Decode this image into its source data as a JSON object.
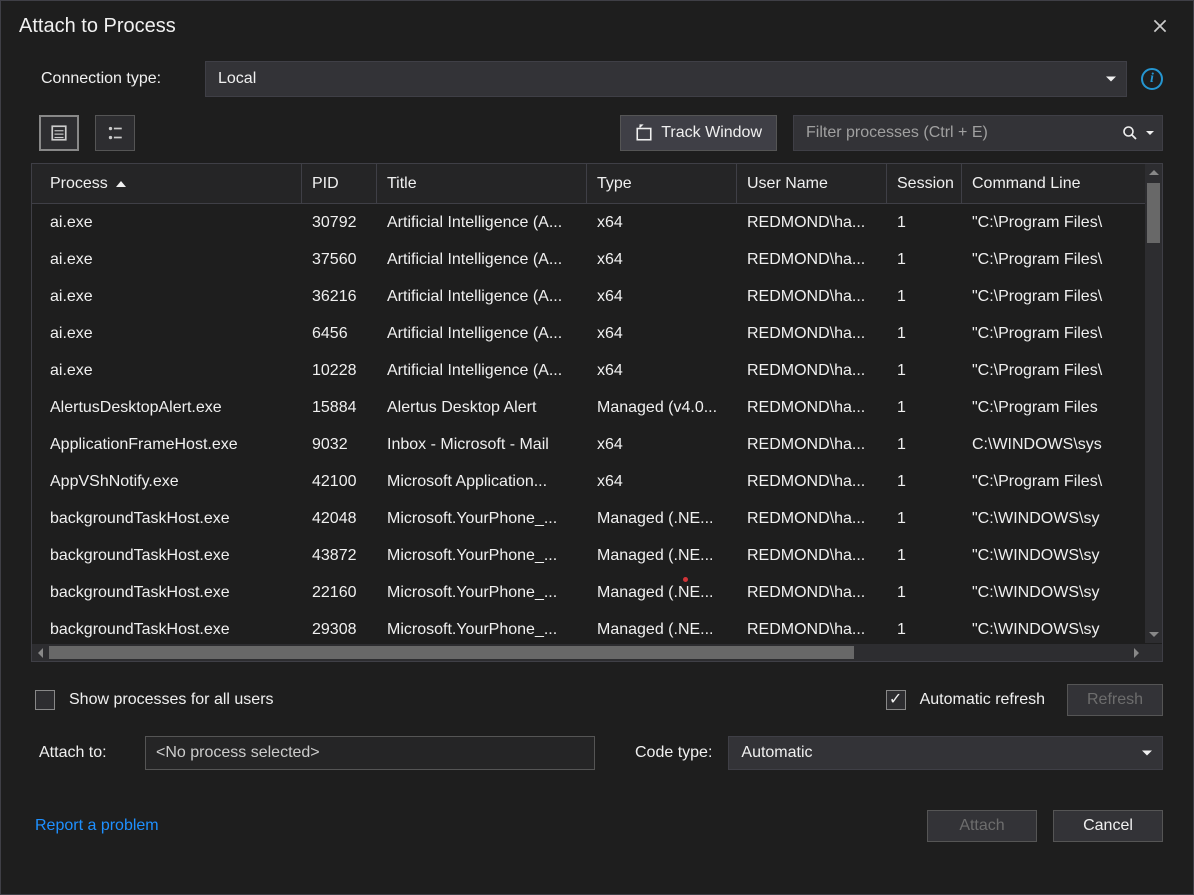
{
  "dialog": {
    "title": "Attach to Process"
  },
  "connection": {
    "label": "Connection type:",
    "value": "Local"
  },
  "toolbar": {
    "track_window": "Track Window",
    "filter_placeholder": "Filter processes (Ctrl + E)"
  },
  "columns": {
    "process": "Process",
    "pid": "PID",
    "title": "Title",
    "type": "Type",
    "user": "User Name",
    "session": "Session",
    "cmd": "Command Line"
  },
  "rows": [
    {
      "process": "ai.exe",
      "pid": "30792",
      "title": "Artificial Intelligence (A...",
      "type": "x64",
      "user": "REDMOND\\ha...",
      "session": "1",
      "cmd": "\"C:\\Program Files\\"
    },
    {
      "process": "ai.exe",
      "pid": "37560",
      "title": "Artificial Intelligence (A...",
      "type": "x64",
      "user": "REDMOND\\ha...",
      "session": "1",
      "cmd": "\"C:\\Program Files\\"
    },
    {
      "process": "ai.exe",
      "pid": "36216",
      "title": "Artificial Intelligence (A...",
      "type": "x64",
      "user": "REDMOND\\ha...",
      "session": "1",
      "cmd": "\"C:\\Program Files\\"
    },
    {
      "process": "ai.exe",
      "pid": "6456",
      "title": "Artificial Intelligence (A...",
      "type": "x64",
      "user": "REDMOND\\ha...",
      "session": "1",
      "cmd": "\"C:\\Program Files\\"
    },
    {
      "process": "ai.exe",
      "pid": "10228",
      "title": "Artificial Intelligence (A...",
      "type": "x64",
      "user": "REDMOND\\ha...",
      "session": "1",
      "cmd": "\"C:\\Program Files\\"
    },
    {
      "process": "AlertusDesktopAlert.exe",
      "pid": "15884",
      "title": "Alertus Desktop Alert",
      "type": "Managed (v4.0...",
      "user": "REDMOND\\ha...",
      "session": "1",
      "cmd": "\"C:\\Program Files"
    },
    {
      "process": "ApplicationFrameHost.exe",
      "pid": "9032",
      "title": "Inbox - Microsoft - Mail",
      "type": "x64",
      "user": "REDMOND\\ha...",
      "session": "1",
      "cmd": "C:\\WINDOWS\\sys"
    },
    {
      "process": "AppVShNotify.exe",
      "pid": "42100",
      "title": "Microsoft Application...",
      "type": "x64",
      "user": "REDMOND\\ha...",
      "session": "1",
      "cmd": "\"C:\\Program Files\\"
    },
    {
      "process": "backgroundTaskHost.exe",
      "pid": "42048",
      "title": "Microsoft.YourPhone_...",
      "type": "Managed (.NE...",
      "user": "REDMOND\\ha...",
      "session": "1",
      "cmd": "\"C:\\WINDOWS\\sy"
    },
    {
      "process": "backgroundTaskHost.exe",
      "pid": "43872",
      "title": "Microsoft.YourPhone_...",
      "type": "Managed (.NE...",
      "user": "REDMOND\\ha...",
      "session": "1",
      "cmd": "\"C:\\WINDOWS\\sy"
    },
    {
      "process": "backgroundTaskHost.exe",
      "pid": "22160",
      "title": "Microsoft.YourPhone_...",
      "type": "Managed (.NE...",
      "user": "REDMOND\\ha...",
      "session": "1",
      "cmd": "\"C:\\WINDOWS\\sy"
    },
    {
      "process": "backgroundTaskHost.exe",
      "pid": "29308",
      "title": "Microsoft.YourPhone_...",
      "type": "Managed (.NE...",
      "user": "REDMOND\\ha...",
      "session": "1",
      "cmd": "\"C:\\WINDOWS\\sy"
    }
  ],
  "options": {
    "show_all_users": "Show processes for all users",
    "auto_refresh": "Automatic refresh",
    "refresh": "Refresh"
  },
  "attach": {
    "label": "Attach to:",
    "value": "<No process selected>",
    "codetype_label": "Code type:",
    "codetype_value": "Automatic"
  },
  "footer": {
    "report": "Report a problem",
    "attach": "Attach",
    "cancel": "Cancel"
  }
}
